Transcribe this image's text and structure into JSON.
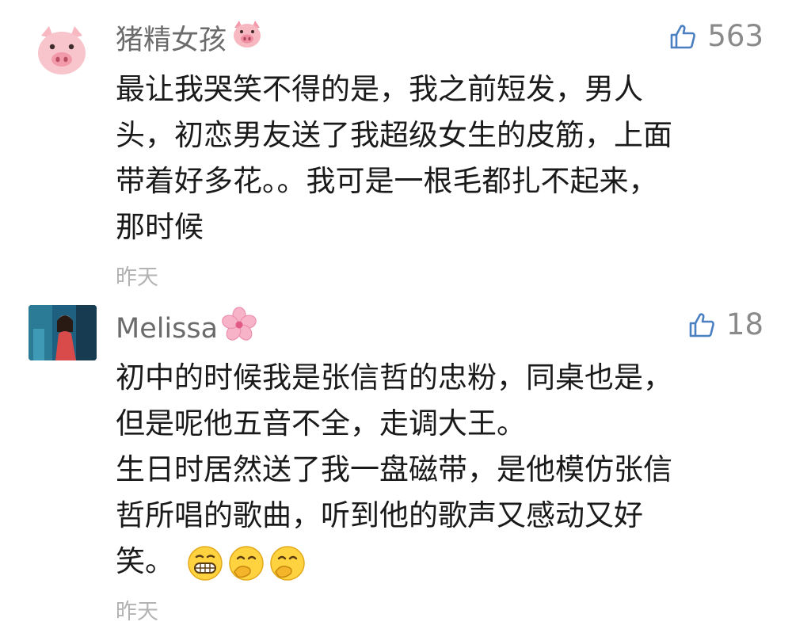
{
  "comments": [
    {
      "username": "猪精女孩",
      "username_emoji": "pig-face",
      "avatar": "pig-face",
      "likes": "563",
      "lines": [
        "最让我哭笑不得的是，我之前短发，男人",
        "头，初恋男友送了我超级女生的皮筋，上面",
        "带着好多花。。我可是一根毛都扎不起来，",
        "那时候"
      ],
      "time": "昨天"
    },
    {
      "username": "Melissa",
      "username_emoji": "cherry-blossom",
      "avatar": "photo",
      "likes": "18",
      "lines": [
        "初中的时候我是张信哲的忠粉，同桌也是，",
        "但是呢他五音不全，走调大王。",
        "生日时居然送了我一盘磁带，是他模仿张信",
        "哲所唱的歌曲，听到他的歌声又感动又好",
        "笑。"
      ],
      "trailing_emojis": [
        "grimacing-face",
        "hand-over-mouth-face",
        "hand-over-mouth-face"
      ],
      "time": "昨天"
    }
  ],
  "colors": {
    "name": "#6b6b6b",
    "body": "#1a1a1a",
    "meta": "#b3b3b3",
    "like": "#4a7fc1",
    "pig": "#f7b8c2"
  }
}
